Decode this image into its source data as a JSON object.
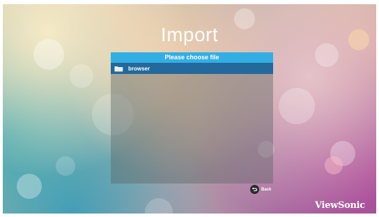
{
  "screen": {
    "title": "Import"
  },
  "file_panel": {
    "header": "Please choose file",
    "items": [
      {
        "label": "browser",
        "icon": "folder-icon",
        "selected": true
      }
    ]
  },
  "back_button": {
    "label": "Back",
    "icon": "back-arrow-icon"
  },
  "brand": {
    "logo": "ViewSonic"
  },
  "colors": {
    "header": "#33aee3",
    "selected_row": "#23699c",
    "text": "#ffffff"
  }
}
